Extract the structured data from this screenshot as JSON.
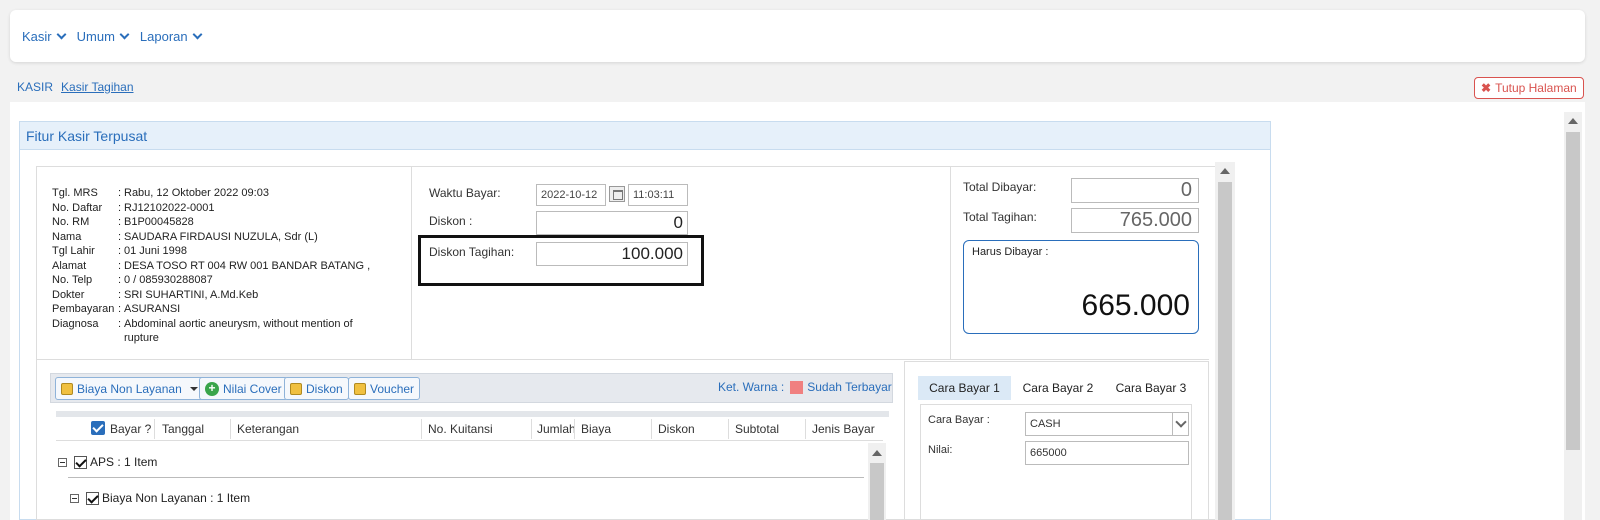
{
  "nav": {
    "items": [
      {
        "label": "Kasir"
      },
      {
        "label": "Umum"
      },
      {
        "label": "Laporan"
      }
    ]
  },
  "breadcrumb": {
    "root": "KASIR",
    "current": "Kasir Tagihan"
  },
  "close_button": "Tutup Halaman",
  "panel": {
    "title": "Fitur Kasir Terpusat"
  },
  "patient": [
    {
      "label": "Tgl. MRS",
      "value": "Rabu, 12 Oktober 2022 09:03"
    },
    {
      "label": "No. Daftar",
      "value": "RJ12102022-0001"
    },
    {
      "label": "No. RM",
      "value": "B1P00045828"
    },
    {
      "label": "Nama",
      "value": "SAUDARA FIRDAUSI NUZULA, Sdr (L)"
    },
    {
      "label": "Tgl Lahir",
      "value": "01 Juni 1998"
    },
    {
      "label": "Alamat",
      "value": "DESA TOSO RT 004 RW 001 BANDAR BATANG ,"
    },
    {
      "label": "No. Telp",
      "value": "0 / 085930288087"
    },
    {
      "label": "Dokter",
      "value": "SRI SUHARTINI, A.Md.Keb"
    },
    {
      "label": "Pembayaran",
      "value": "ASURANSI"
    },
    {
      "label": "Diagnosa",
      "value": "Abdominal aortic aneurysm, without mention of rupture"
    }
  ],
  "payment_time": {
    "waktu_label": "Waktu Bayar:",
    "date": "2022-10-12",
    "time": "11:03:11",
    "diskon_label": "Diskon :",
    "diskon_value": "0",
    "diskon_tagihan_label": "Diskon Tagihan:",
    "diskon_tagihan_value": "100.000"
  },
  "totals": {
    "dibayar_label": "Total Dibayar:",
    "dibayar_value": "0",
    "tagihan_label": "Total Tagihan:",
    "tagihan_value": "765.000",
    "harus_label": "Harus Dibayar :",
    "harus_value": "665.000"
  },
  "toolbar": {
    "biaya_non_layanan": "Biaya Non Layanan",
    "nilai_cover": "Nilai Cover",
    "diskon": "Diskon",
    "voucher": "Voucher",
    "legend_label": "Ket. Warna :",
    "legend_item": "Sudah Terbayar",
    "legend_color": "#f08080"
  },
  "grid": {
    "columns": [
      "Bayar ?",
      "Tanggal",
      "Keterangan",
      "No. Kuitansi",
      "Jumlah",
      "Biaya",
      "Diskon",
      "Subtotal",
      "Jenis Bayar"
    ],
    "rows": [
      {
        "label": "APS : 1 Item"
      },
      {
        "label": "Biaya Non Layanan : 1 Item"
      }
    ]
  },
  "payment_method": {
    "tabs": [
      "Cara Bayar 1",
      "Cara Bayar 2",
      "Cara Bayar 3"
    ],
    "cara_label": "Cara Bayar :",
    "cara_value": "CASH",
    "nilai_label": "Nilai:",
    "nilai_value": "665000"
  }
}
